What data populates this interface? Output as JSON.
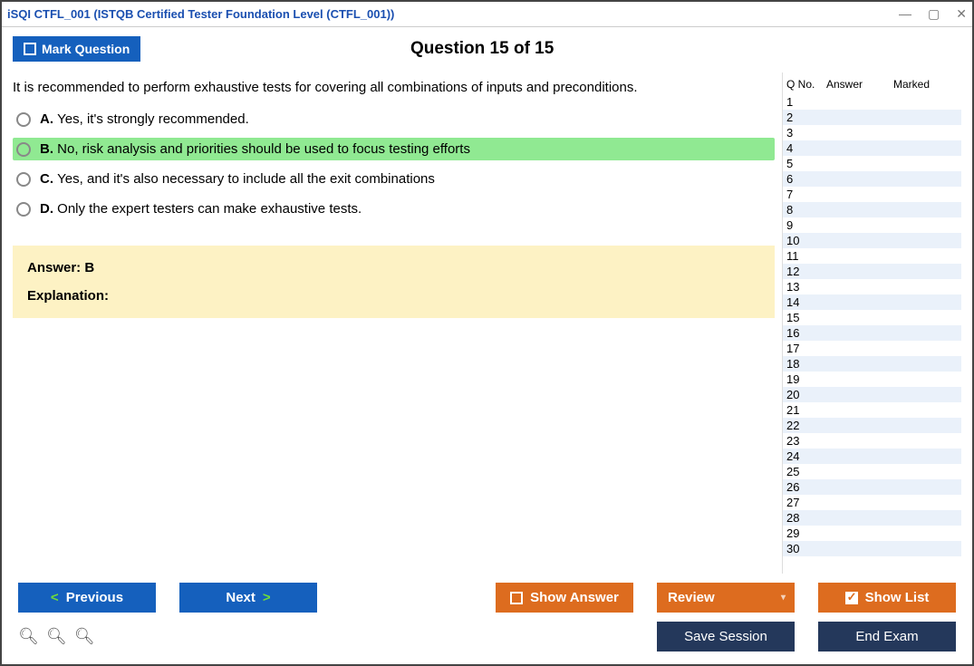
{
  "window": {
    "title": "iSQI CTFL_001 (ISTQB Certified Tester Foundation Level (CTFL_001))"
  },
  "header": {
    "mark_label": "Mark Question",
    "question_title": "Question 15 of 15"
  },
  "question": {
    "text": "It is recommended to perform exhaustive tests for covering all combinations of inputs and preconditions.",
    "options": [
      {
        "letter": "A.",
        "text": "Yes, it's strongly recommended.",
        "selected": false
      },
      {
        "letter": "B.",
        "text": "No, risk analysis and priorities should be used to focus testing efforts",
        "selected": true
      },
      {
        "letter": "C.",
        "text": "Yes, and it's also necessary to include all the exit combinations",
        "selected": false
      },
      {
        "letter": "D.",
        "text": "Only the expert testers can make exhaustive tests.",
        "selected": false
      }
    ]
  },
  "answer_box": {
    "answer_label": "Answer: B",
    "explanation_label": "Explanation:"
  },
  "side_panel": {
    "headers": {
      "qno": "Q No.",
      "answer": "Answer",
      "marked": "Marked"
    },
    "rows": [
      1,
      2,
      3,
      4,
      5,
      6,
      7,
      8,
      9,
      10,
      11,
      12,
      13,
      14,
      15,
      16,
      17,
      18,
      19,
      20,
      21,
      22,
      23,
      24,
      25,
      26,
      27,
      28,
      29,
      30
    ]
  },
  "footer": {
    "previous": "Previous",
    "next": "Next",
    "show_answer": "Show Answer",
    "review": "Review",
    "show_list": "Show List",
    "save_session": "Save Session",
    "end_exam": "End Exam"
  }
}
